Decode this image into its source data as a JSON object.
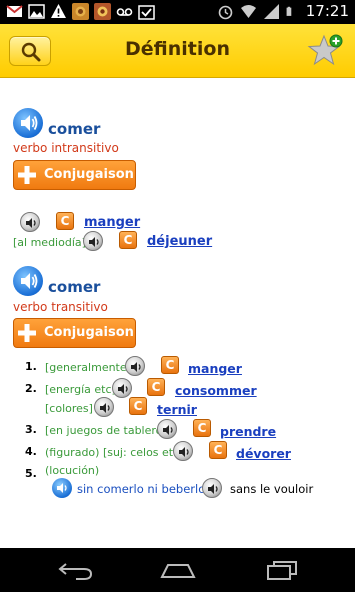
{
  "status_bar": {
    "time": "17:21",
    "left_icons": [
      "gmail-icon",
      "image-icon",
      "warning-icon",
      "app-icon",
      "app-icon-2",
      "voicemail-icon",
      "download-done-icon"
    ],
    "right_icons": [
      "alarm-icon",
      "wifi-icon",
      "signal-icon",
      "battery-icon"
    ]
  },
  "header": {
    "title": "Définition",
    "search_icon": "search-icon",
    "favorite_icon": "star-add-icon"
  },
  "entries": [
    {
      "headword": "comer",
      "pos": "verbo intransitivo",
      "conj_label": "Conjugaison",
      "translations": [
        {
          "context": "",
          "word": "manger"
        },
        {
          "context": "[al mediodía]",
          "word": "déjeuner"
        }
      ]
    },
    {
      "headword": "comer",
      "pos": "verbo transitivo",
      "conj_label": "Conjugaison",
      "senses": [
        {
          "num": "1.",
          "lines": [
            {
              "context": "[generalmente]",
              "word": "manger"
            }
          ]
        },
        {
          "num": "2.",
          "lines": [
            {
              "context": "[energía etc]",
              "word": "consommer"
            },
            {
              "context": "[colores]",
              "word": "ternir"
            }
          ]
        },
        {
          "num": "3.",
          "lines": [
            {
              "context": "[en juegos de tablero]",
              "word": "prendre"
            }
          ]
        },
        {
          "num": "4.",
          "lines": [
            {
              "context": "(figurado) [suj: celos etc]",
              "word": "dévorer"
            }
          ]
        },
        {
          "num": "5.",
          "label": "(locución)",
          "locution": "sin comerlo ni beberlo",
          "locution_translation": "sans le vouloir"
        }
      ]
    }
  ],
  "colors": {
    "header_bg": "#ffd21a",
    "link": "#1a3fbf",
    "context": "#3a9a3a",
    "pos": "#d23a1a",
    "headword": "#1a4f9c",
    "conj_button": "#f07a10"
  },
  "conjugation_badge": "C",
  "navbar": {
    "icons": [
      "back-icon",
      "home-icon",
      "recent-apps-icon"
    ]
  }
}
